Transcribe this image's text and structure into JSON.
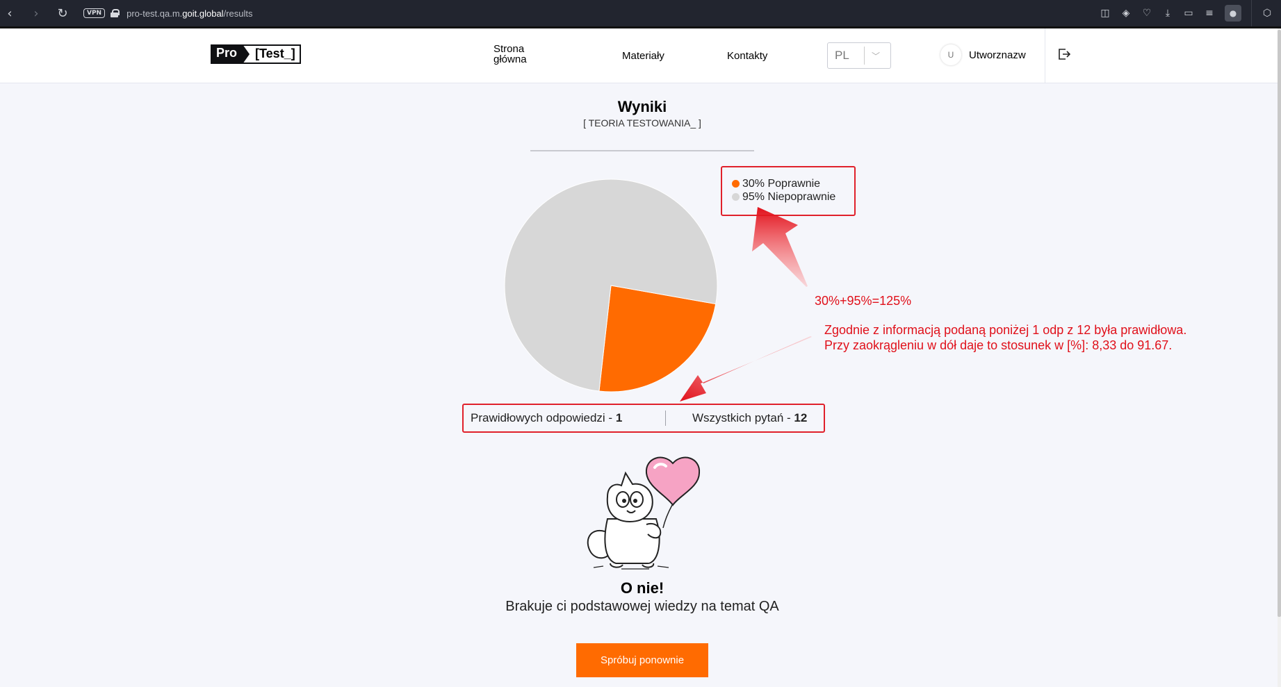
{
  "browser": {
    "vpn_label": "VPN",
    "url_prefix": "pro-test.qa.m.",
    "url_domain": "goit.global",
    "url_path": "/results"
  },
  "header": {
    "logo_pro": "Pro",
    "logo_test": "[Test_]",
    "nav": {
      "home": "Strona główna",
      "materials": "Materiały",
      "contacts": "Kontakty"
    },
    "language": "PL",
    "avatar_initial": "U",
    "username": "Utworznazw"
  },
  "results": {
    "title": "Wyniki",
    "subtitle": "[ TEORIA TESTOWANIA_ ]",
    "legend": {
      "correct": "30% Poprawnie",
      "incorrect": "95% Niepoprawnie"
    },
    "stats": {
      "correct_label": "Prawidłowych odpowiedzi - ",
      "correct_value": "1",
      "total_label": "Wszystkich pytań - ",
      "total_value": "12"
    },
    "oops_title": "O nie!",
    "oops_message": "Brakuje ci podstawowej wiedzy na temat QA",
    "retry_label": "Spróbuj ponownie"
  },
  "annotations": {
    "sum_note": "30%+95%=125%",
    "explanation_line1": "Zgodnie z informacją podaną poniżej 1 odp z 12 była prawidłowa.",
    "explanation_line2": "Przy zaokrągleniu w dół daje to stosunek w [%]: 8,33 do 91.67."
  },
  "chart_data": {
    "type": "pie",
    "series": [
      {
        "name": "Poprawnie",
        "value": 30,
        "color": "#ff6b01"
      },
      {
        "name": "Niepoprawnie",
        "value": 95,
        "color": "#d7d7d7"
      }
    ],
    "legend_placement": "top-right"
  },
  "colors": {
    "accent": "#ff6b01",
    "incorrect": "#d7d7d7",
    "annotation_red": "#e0101a"
  }
}
